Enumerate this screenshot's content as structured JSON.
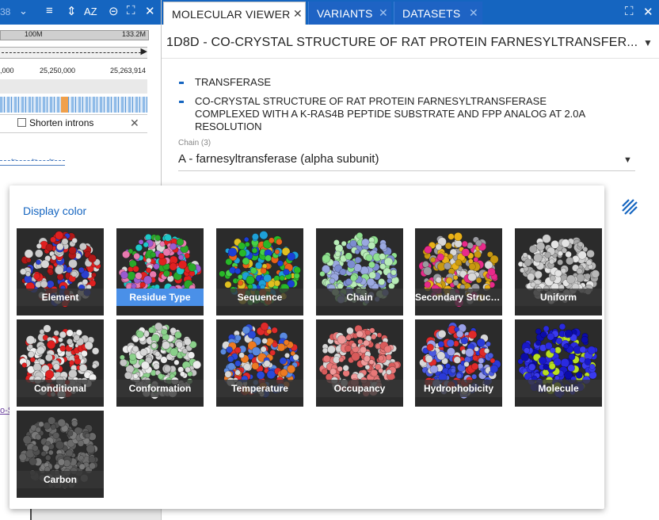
{
  "genome_panel": {
    "toolbar_number": "38",
    "ruler_labels": [
      "100M",
      "133.2M"
    ],
    "coord_labels": [
      ",000",
      "25,250,000",
      "25,263,914"
    ],
    "shorten_introns_label": "Shorten introns",
    "link_fragment": "o-S"
  },
  "tabs": [
    {
      "label": "MOLECULAR VIEWER",
      "active": true
    },
    {
      "label": "VARIANTS",
      "active": false
    },
    {
      "label": "DATASETS",
      "active": false
    }
  ],
  "molecule": {
    "title": "1D8D  - CO-CRYSTAL STRUCTURE OF RAT PROTEIN FARNESYLTRANSFER...",
    "descriptions": [
      "TRANSFERASE",
      "CO-CRYSTAL STRUCTURE OF RAT PROTEIN FARNESYLTRANSFERASE",
      "COMPLEXED WITH A K-RAS4B PEPTIDE SUBSTRATE AND FPP ANALOG AT 2.0A",
      "RESOLUTION"
    ],
    "chain_caption": "Chain (3)",
    "chain_selected": "A - farnesyltransferase (alpha subunit)"
  },
  "display_color": {
    "title": "Display color",
    "selected": "Residue Type",
    "options": [
      {
        "label": "Element",
        "palette": [
          "#d8d8d8",
          "#e02020",
          "#2b3fd0",
          "#c9c9c9",
          "#b01818"
        ]
      },
      {
        "label": "Residue Type",
        "palette": [
          "#e02020",
          "#1ec8c8",
          "#2aa82a",
          "#9a5bd0",
          "#e87ab0",
          "#d8d8d8"
        ]
      },
      {
        "label": "Sequence",
        "palette": [
          "#1b3fd6",
          "#28b828",
          "#e0c020",
          "#e86018",
          "#1ea0d8",
          "#46d046"
        ]
      },
      {
        "label": "Chain",
        "palette": [
          "#8fe08f",
          "#9aa8e0",
          "#b8ecb8",
          "#7c8cd0"
        ]
      },
      {
        "label": "Secondary Structure",
        "palette": [
          "#e8b018",
          "#d8d8d8",
          "#e82a8a",
          "#c89810",
          "#9a9aa0"
        ]
      },
      {
        "label": "Uniform",
        "palette": [
          "#d0d0d0",
          "#b8b8b8",
          "#e4e4e4",
          "#a8a8a8"
        ]
      },
      {
        "label": "Conditional",
        "palette": [
          "#d8d8d8",
          "#e02020",
          "#c8c8c8",
          "#f0f0f0"
        ]
      },
      {
        "label": "Conformation",
        "palette": [
          "#d8d8d8",
          "#c4c4c4",
          "#ececec",
          "#8ad08a"
        ]
      },
      {
        "label": "Temperature",
        "palette": [
          "#2a4ad8",
          "#e02a2a",
          "#d8d8d8",
          "#ec7a22",
          "#5a8ae0"
        ]
      },
      {
        "label": "Occupancy",
        "palette": [
          "#e87878",
          "#d85a5a",
          "#f09a9a",
          "#d8d8d8"
        ]
      },
      {
        "label": "Hydrophobicity",
        "palette": [
          "#2a3ad8",
          "#e02a2a",
          "#d8d8d8",
          "#4a5ae0",
          "#9aa0e8"
        ]
      },
      {
        "label": "Molecule",
        "palette": [
          "#1818c8",
          "#2a2ae0",
          "#0c0ca8",
          "#3a3af0",
          "#b8e020"
        ]
      },
      {
        "label": "Carbon",
        "palette": [
          "#6a6a6a",
          "#5a5a5a",
          "#7a7a7a",
          "#4e4e4e"
        ]
      }
    ]
  }
}
